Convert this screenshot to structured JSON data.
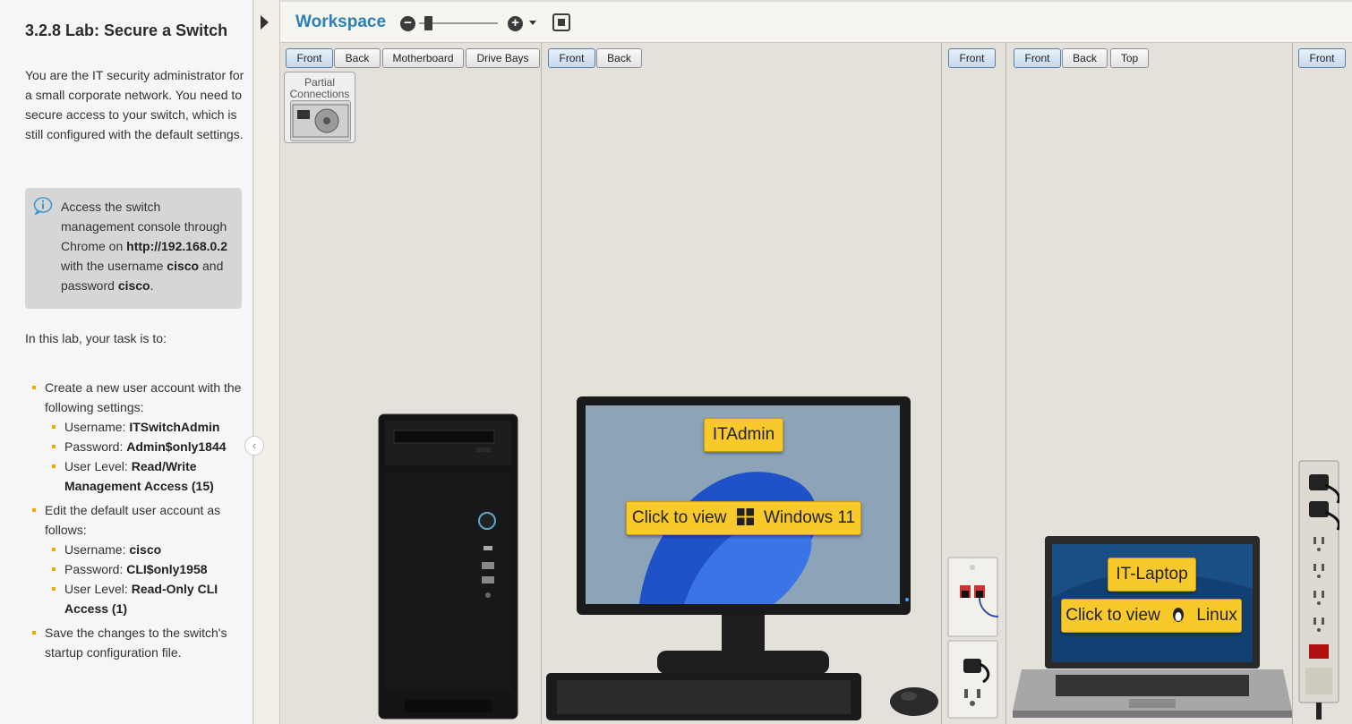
{
  "lab": {
    "title": "3.2.8 Lab: Secure a Switch",
    "intro": "You are the IT security administrator for a small corporate network. You need to secure access to your switch, which is still configured with the default settings.",
    "note": {
      "t1": "Access the switch management console through Chrome on ",
      "url": "http://192.168.0.2",
      "t2": " with the username ",
      "user": "cisco",
      "t3": " and password ",
      "pass": "cisco",
      "t4": "."
    },
    "task_intro": "In this lab, your task is to:",
    "tasks": [
      {
        "text": "Create a new user account with the following settings:",
        "sub": [
          {
            "label": "Username: ",
            "value": "ITSwitchAdmin"
          },
          {
            "label": "Password: ",
            "value": "Admin$only1844"
          },
          {
            "label": "User Level: ",
            "value": "Read/Write Management Access (15)"
          }
        ]
      },
      {
        "text": "Edit the default user account as follows:",
        "sub": [
          {
            "label": "Username: ",
            "value": "cisco"
          },
          {
            "label": "Password: ",
            "value": "CLI$only1958"
          },
          {
            "label": "User Level: ",
            "value": "Read-Only CLI Access (1)"
          }
        ]
      },
      {
        "text": "Save the changes to the switch's startup configuration file.",
        "sub": []
      }
    ]
  },
  "toolbar": {
    "title": "Workspace",
    "zoom_out": "−",
    "zoom_in": "+"
  },
  "views": {
    "tower": [
      "Front",
      "Back",
      "Motherboard",
      "Drive Bays"
    ],
    "monitor": [
      "Front",
      "Back"
    ],
    "wallplate": [
      "Front"
    ],
    "laptop": [
      "Front",
      "Back",
      "Top"
    ],
    "powerstrip": [
      "Front"
    ]
  },
  "partial_connections": "Partial Connections",
  "devices": {
    "itadmin": {
      "name": "ITAdmin",
      "click": "Click to view",
      "os": "Windows 11"
    },
    "laptop": {
      "name": "IT-Laptop",
      "click": "Click to view",
      "os": "Linux"
    }
  }
}
